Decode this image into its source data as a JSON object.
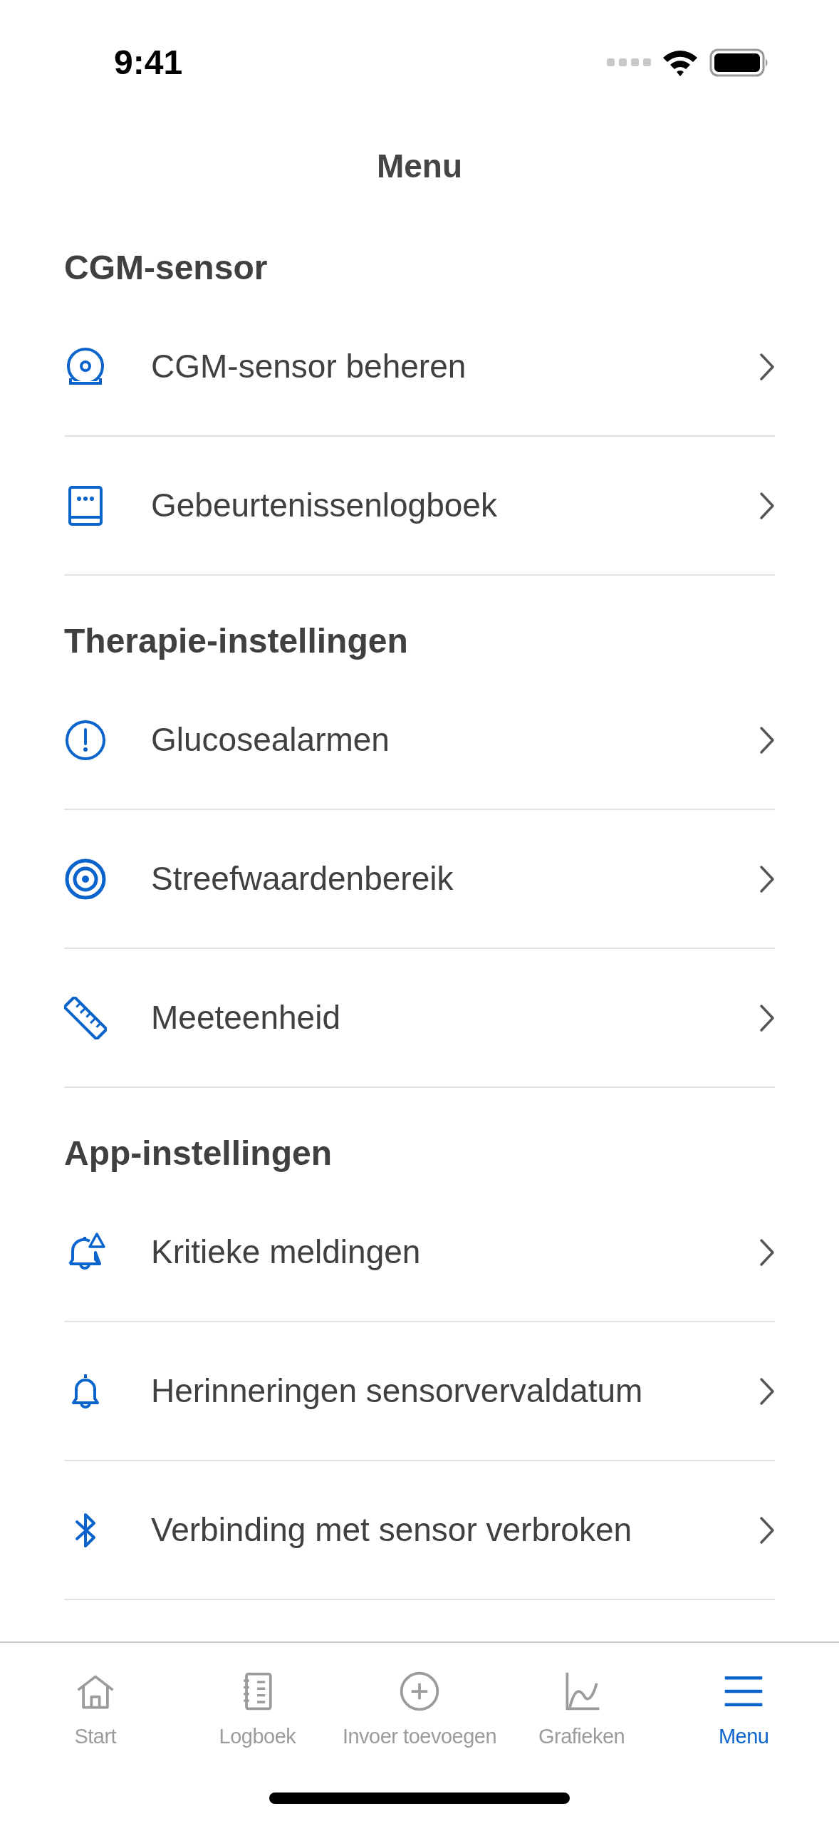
{
  "status_bar": {
    "time": "9:41"
  },
  "title": "Menu",
  "sections": [
    {
      "heading": "CGM-sensor",
      "items": [
        {
          "label": "CGM-sensor beheren"
        },
        {
          "label": "Gebeurtenissenlogboek"
        }
      ]
    },
    {
      "heading": "Therapie-instellingen",
      "items": [
        {
          "label": "Glucosealarmen"
        },
        {
          "label": "Streefwaardenbereik"
        },
        {
          "label": "Meeteenheid"
        }
      ]
    },
    {
      "heading": "App-instellingen",
      "items": [
        {
          "label": "Kritieke meldingen"
        },
        {
          "label": "Herinneringen sensorvervaldatum"
        },
        {
          "label": "Verbinding met sensor verbroken"
        }
      ]
    }
  ],
  "tab_bar": [
    {
      "label": "Start",
      "selected": false
    },
    {
      "label": "Logboek",
      "selected": false
    },
    {
      "label": "Invoer toevoegen",
      "selected": false
    },
    {
      "label": "Grafieken",
      "selected": false
    },
    {
      "label": "Menu",
      "selected": true
    }
  ]
}
